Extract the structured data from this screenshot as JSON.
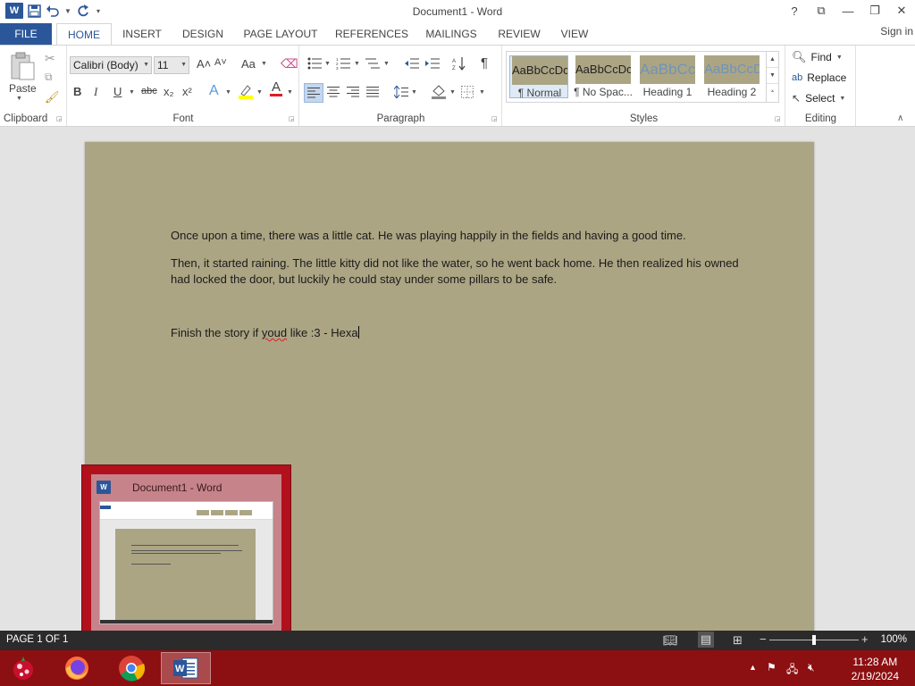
{
  "window": {
    "title": "Document1 - Word",
    "controls": [
      "?",
      "⧉",
      "—",
      "❐",
      "✕"
    ]
  },
  "qat": {
    "app_icon_letter": "W",
    "save_icon": "save-icon",
    "undo_icon": "undo-icon",
    "redo_icon": "redo-icon"
  },
  "ribbon_tabs": [
    "FILE",
    "HOME",
    "INSERT",
    "DESIGN",
    "PAGE LAYOUT",
    "REFERENCES",
    "MAILINGS",
    "REVIEW",
    "VIEW"
  ],
  "active_tab": "HOME",
  "signin": "Sign in",
  "clipboard": {
    "paste_label": "Paste",
    "group_label": "Clipboard"
  },
  "font": {
    "name": "Calibri (Body)",
    "size": "11",
    "group_label": "Font",
    "bold": "B",
    "italic": "I",
    "underline": "U",
    "strike": "abc",
    "subscript": "x₂",
    "superscript": "x²",
    "grow": "A˄",
    "shrink": "A˅",
    "change_case": "Aa",
    "font_color_letter": "A",
    "highlight_color": "#ffff00",
    "font_color": "#e01b24"
  },
  "paragraph": {
    "group_label": "Paragraph",
    "show_marks": "¶"
  },
  "styles": {
    "group_label": "Styles",
    "items": [
      {
        "preview": "AaBbCcDc",
        "name": "¶ Normal"
      },
      {
        "preview": "AaBbCcDc",
        "name": "¶ No Spac..."
      },
      {
        "preview": "AaBbCc",
        "name": "Heading 1"
      },
      {
        "preview": "AaBbCcD",
        "name": "Heading 2"
      }
    ],
    "swatch_color": "#aca584",
    "heading_color": "#6f94b8"
  },
  "editing": {
    "group_label": "Editing",
    "find": "Find",
    "replace": "Replace",
    "select": "Select"
  },
  "document": {
    "page_color": "#aca584",
    "paragraphs": [
      "Once upon a time, there was a little cat. He was playing happily in the fields and having a good time.",
      "Then, it started raining. The little kitty did not like the water, so he went back home. He then realized his owned had locked the door, but luckily he could stay under some pillars to be safe."
    ],
    "last_line_before": "Finish the story if ",
    "last_line_misspelled": "youd",
    "last_line_after": " like :3 - Hexa"
  },
  "preview_popup": {
    "title": "Document1 - Word",
    "bg_color": "#b2101c"
  },
  "statusbar": {
    "page_info": "PAGE 1 OF 1",
    "zoom": "100%",
    "zoom_level_percent": 100
  },
  "taskbar": {
    "color": "#8c0f12",
    "apps": [
      "start-orb",
      "firefox",
      "chrome",
      "word"
    ],
    "clock_time": "11:28 AM",
    "clock_date": "2/19/2024"
  }
}
